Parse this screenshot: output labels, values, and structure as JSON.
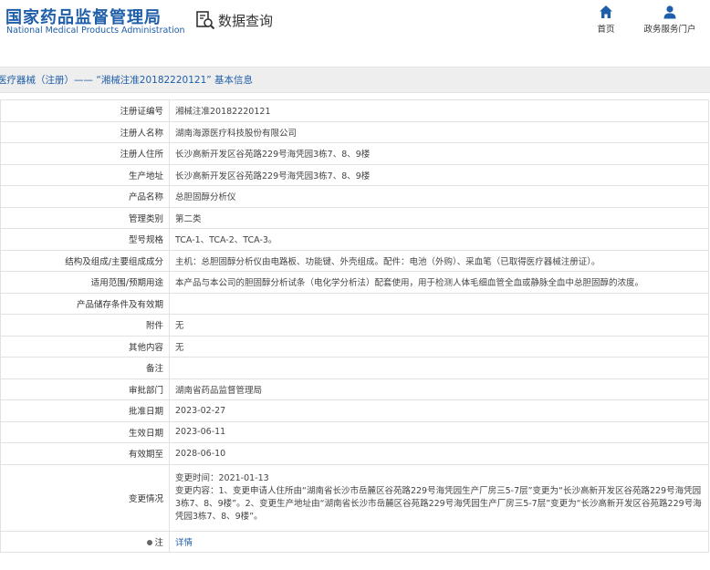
{
  "header": {
    "logo_cn": "国家药品监督管理局",
    "logo_en": "National Medical Products Administration",
    "query_label": "数据查询",
    "nav": [
      {
        "label": "首页",
        "icon": "home-icon"
      },
      {
        "label": "政务服务门户",
        "icon": "user-icon"
      }
    ]
  },
  "title": "医疗器械（注册）—— “湘械注准20182220121” 基本信息",
  "colors": {
    "brand": "#1f5ea8",
    "border": "#e2e2e2",
    "titlebar_bg": "#eeeeee"
  },
  "rows": [
    {
      "key": "注册证编号",
      "value": "湘械注准20182220121"
    },
    {
      "key": "注册人名称",
      "value": "湖南海源医疗科技股份有限公司"
    },
    {
      "key": "注册人住所",
      "value": "长沙高新开发区谷苑路229号海凭园3栋7、8、9楼"
    },
    {
      "key": "生产地址",
      "value": "长沙高新开发区谷苑路229号海凭园3栋7、8、9楼"
    },
    {
      "key": "产品名称",
      "value": "总胆固醇分析仪"
    },
    {
      "key": "管理类别",
      "value": "第二类"
    },
    {
      "key": "型号规格",
      "value": "TCA-1、TCA-2、TCA-3。"
    },
    {
      "key": "结构及组成/主要组成成分",
      "value": "主机：总胆固醇分析仪由电路板、功能键、外壳组成。配件：电池（外购）、采血笔（已取得医疗器械注册证）。"
    },
    {
      "key": "适用范围/预期用途",
      "value": "本产品与本公司的胆固醇分析试条（电化学分析法）配套使用，用于检测人体毛细血管全血或静脉全血中总胆固醇的浓度。"
    },
    {
      "key": "产品储存条件及有效期",
      "value": ""
    },
    {
      "key": "附件",
      "value": "无"
    },
    {
      "key": "其他内容",
      "value": "无"
    },
    {
      "key": "备注",
      "value": ""
    },
    {
      "key": "审批部门",
      "value": "湖南省药品监督管理局"
    },
    {
      "key": "批准日期",
      "value": "2023-02-27"
    },
    {
      "key": "生效日期",
      "value": "2023-06-11"
    },
    {
      "key": "有效期至",
      "value": "2028-06-10"
    }
  ],
  "change": {
    "key": "变更情况",
    "line1": "变更时间：2021-01-13",
    "line2": "变更内容：1、变更申请人住所由“湖南省长沙市岳麓区谷苑路229号海凭园生产厂房三5-7层”变更为“长沙高新开发区谷苑路229号海凭园3栋7、8、9楼”。2、变更生产地址由“湖南省长沙市岳麓区谷苑路229号海凭园生产厂房三5-7层”变更为“长沙高新开发区谷苑路229号海凭园3栋7、8、9楼”。"
  },
  "note": {
    "key": "注",
    "link": "详情"
  }
}
